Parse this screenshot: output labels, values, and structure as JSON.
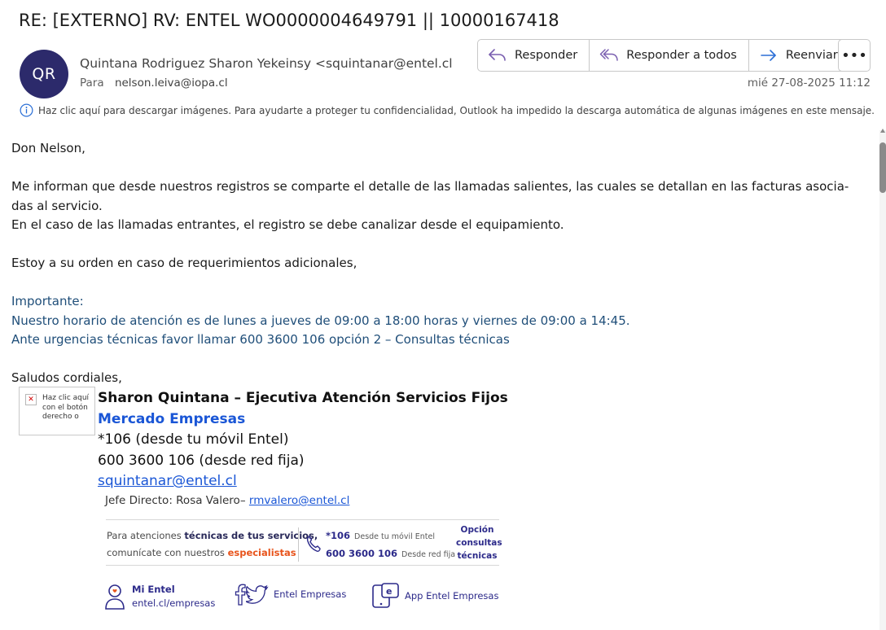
{
  "subject": "RE: [EXTERNO] RV: ENTEL WO0000004649791 ||  10000167418",
  "sender": {
    "initials": "QR",
    "display": "Quintana Rodriguez Sharon Yekeinsy <squintanar@entel.cl",
    "to_label": "Para",
    "to_address": "nelson.leiva@iopa.cl",
    "datetime": "mié 27-08-2025 11:12"
  },
  "actions": {
    "reply": "Responder",
    "reply_all": "Responder a todos",
    "forward": "Reenviar",
    "more": "•••"
  },
  "info_bar": "Haz clic aquí para descargar imágenes. Para ayudarte a proteger tu confidencialidad, Outlook ha impedido la descarga automática de algunas imágenes en este mensaje.",
  "body": {
    "greeting": "Don Nelson,",
    "p1_line1": "Me informan que desde nuestros registros se comparte el detalle de las llamadas salientes, las cuales se detallan en las facturas asocia-",
    "p1_line2": "das al servicio.",
    "p1_line3": "En el caso de las llamadas entrantes, el registro se debe canalizar desde el equipamiento.",
    "p2": "Estoy a su orden en caso de requerimientos adicionales,",
    "important_label": "Importante:",
    "important_line1": "Nuestro horario de atención es de lunes a jueves de 09:00 a 18:00 horas y viernes de 09:00 a 14:45.",
    "important_line2": "Ante urgencias técnicas favor llamar 600 3600 106 opción 2 – Consultas técnicas",
    "closing": "Saludos cordiales,"
  },
  "image_placeholder": "Haz clic aquí con el botón derecho o",
  "signature": {
    "name": "Sharon Quintana – Ejecutiva Atención Servicios Fijos",
    "dept": "Mercado Empresas",
    "mobile": "*106 (desde tu móvil Entel)",
    "landline": "600 3600 106 (desde red fija)",
    "email": "squintanar@entel.cl",
    "jefe_label": "Jefe Directo: Rosa Valero–",
    "jefe_email": "rmvalero@entel.cl"
  },
  "banner": {
    "left_1a": "Para atenciones ",
    "left_1b": "técnicas de tus servicios,",
    "left_2a": "comunícate con nuestros ",
    "left_2b": "especialistas",
    "mid_1": "*106",
    "mid_1_small": "Desde tu móvil Entel",
    "mid_2": "600 3600 106",
    "mid_2_small": "Desde red fija",
    "right_1": "Opción",
    "right_2": "consultas",
    "right_3": "técnicas"
  },
  "footer": {
    "mientel_title": "Mi Entel",
    "mientel_url": "entel.cl/empresas",
    "social": "Entel Empresas",
    "app": "App Entel Empresas"
  },
  "colors": {
    "avatar": "#2c2a6b",
    "link_blue": "#1a56d6",
    "important_blue": "#1f4e79",
    "orange": "#e8541c",
    "navy": "#2c2a8a"
  }
}
